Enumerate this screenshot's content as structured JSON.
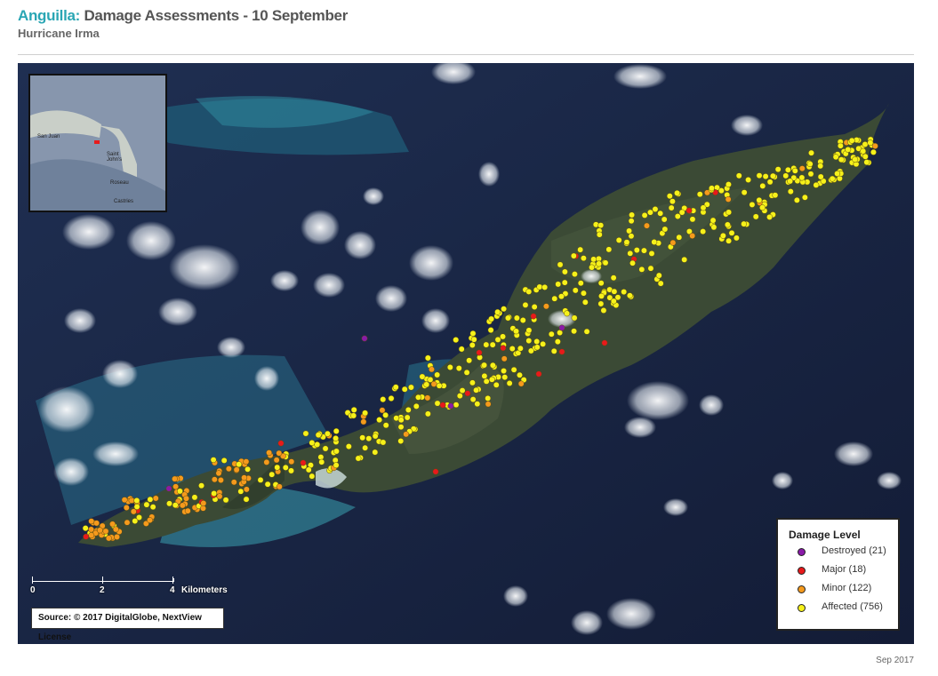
{
  "header": {
    "country": "Anguilla:",
    "title": "Damage Assessments - 10 September",
    "subtitle": "Hurricane Irma"
  },
  "inset_map": {
    "labels": [
      "San Juan",
      "Saint John's",
      "Roseau",
      "Castries"
    ]
  },
  "scale": {
    "ticks": [
      "0",
      "2",
      "4"
    ],
    "unit": "Kilometers"
  },
  "source": "Source: © 2017 DigitalGlobe, NextView License",
  "legend": {
    "title": "Damage Level",
    "items": [
      {
        "label": "Destroyed (21)",
        "color": "#8a1aa8"
      },
      {
        "label": "Major (18)",
        "color": "#e8191b"
      },
      {
        "label": "Minor (122)",
        "color": "#f59a1d"
      },
      {
        "label": "Affected (756)",
        "color": "#f6f11a"
      }
    ]
  },
  "colors": {
    "title_accent": "#2aa6b4",
    "ocean": "#17233f",
    "land": "#3b4a35",
    "reef": "#2f8fa3"
  },
  "footer": {
    "date": "Sep 2017"
  }
}
